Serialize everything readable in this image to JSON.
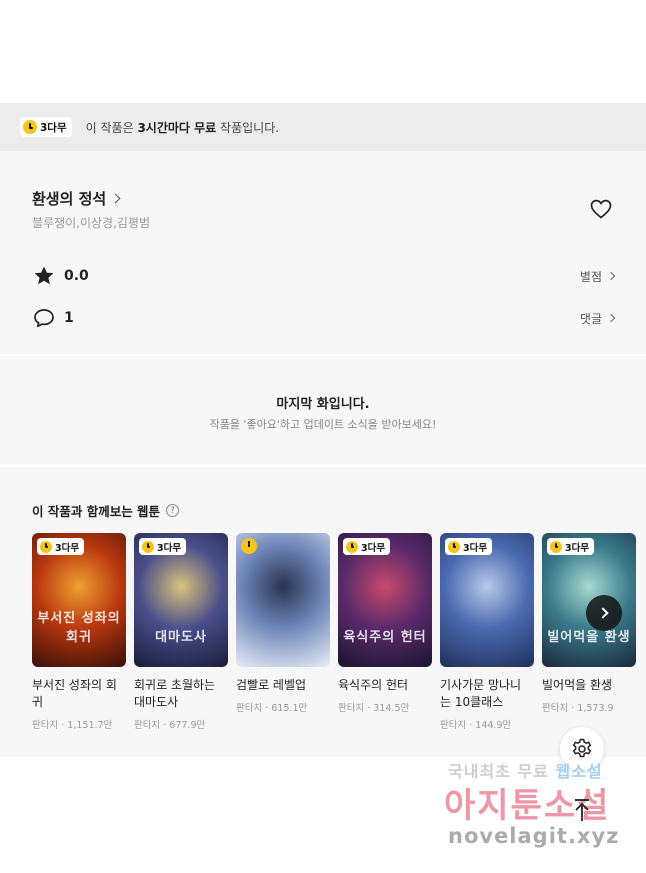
{
  "notice": {
    "badge_label": "3다무",
    "text_prefix": "이 작품은 ",
    "text_bold": "3시간마다 무료",
    "text_suffix": " 작품입니다."
  },
  "work": {
    "title": "환생의 정석",
    "authors": "블루쟁이,이상경,김평범",
    "rating": "0.0",
    "rating_link": "별점",
    "comment_count": "1",
    "comment_link": "댓글"
  },
  "last_episode": {
    "title": "마지막 화입니다.",
    "subtitle": "작품을 '좋아요'하고 업데이트 소식을 받아보세요!"
  },
  "recommendations": {
    "title": "이 작품과 함께보는 웹툰",
    "help_glyph": "?",
    "items": [
      {
        "badge": "3다무",
        "name": "부서진 성좌의 회귀",
        "genre": "판타지",
        "views": "1,151.7만",
        "cover_text": "부서진 성좌의 회귀",
        "colors": [
          "#3a0f08",
          "#b8380f",
          "#f0a030"
        ]
      },
      {
        "badge": "3다무",
        "name": "회귀로 초월하는 대마도사",
        "genre": "판타지",
        "views": "677.9만",
        "cover_text": "대마도사",
        "colors": [
          "#1a1c3a",
          "#4a4f8a",
          "#d8c27a"
        ]
      },
      {
        "badge": "",
        "name": "검빨로 레벨업",
        "genre": "판타지",
        "views": "615.1만",
        "cover_text": "",
        "colors": [
          "#e8eef7",
          "#6f86b8",
          "#2a3350"
        ]
      },
      {
        "badge": "3다무",
        "name": "육식주의 헌터",
        "genre": "판타지",
        "views": "314.5만",
        "cover_text": "육식주의 헌터",
        "colors": [
          "#1a1430",
          "#5a2a6a",
          "#c84a6a"
        ]
      },
      {
        "badge": "3다무",
        "name": "기사가문 망나니는 10클래스",
        "genre": "판타지",
        "views": "144.9만",
        "cover_text": "",
        "colors": [
          "#22305a",
          "#4a6ab0",
          "#b8c8e8"
        ]
      },
      {
        "badge": "3다무",
        "name": "빌어먹을 환생",
        "genre": "판타지",
        "views": "1,573.9",
        "cover_text": "빌어먹을 환생",
        "colors": [
          "#1a2a3a",
          "#3a7a8a",
          "#a8d8d0"
        ]
      }
    ]
  },
  "watermark": {
    "line1_a": "국내최초 무료 ",
    "line1_b": "웹소설",
    "line2": "아지툰소설",
    "line3": "novelagit.xyz"
  },
  "icons": {
    "heart": "heart-icon",
    "star": "star-icon",
    "comment": "comment-icon",
    "settings": "gear-icon",
    "scroll_top": "arrow-up-icon",
    "next": "chevron-right-icon"
  },
  "colors": {
    "accent_yellow": "#f5c518",
    "notice_bg": "#ececec",
    "section_bg": "#f7f7f7"
  }
}
